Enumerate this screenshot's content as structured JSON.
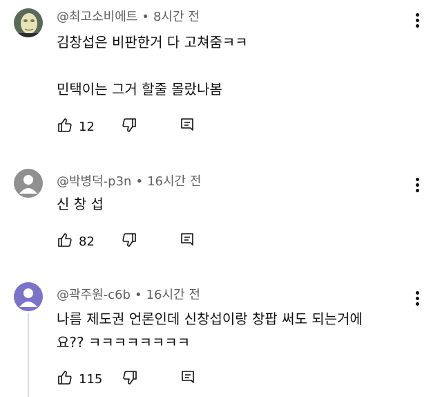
{
  "comments": [
    {
      "author": "@최고소비에트",
      "time": "8시간 전",
      "text": "김창섭은 비판한거 다 고쳐줌ㅋㅋ\n\n민택이는 그거 할줄 몰랐나봄",
      "likes": "12",
      "avatar": "photo"
    },
    {
      "author": "@박병덕-p3n",
      "time": "16시간 전",
      "text": "신 창 섭",
      "likes": "82",
      "avatar": "default-gray"
    },
    {
      "author": "@곽주원-c6b",
      "time": "16시간 전",
      "text": "나름 제도권 언론인데 신창섭이랑 창팝 써도 되는거에\n요?? ㅋㅋㅋㅋㅋㅋㅋㅋ",
      "likes": "115",
      "avatar": "default-purple"
    }
  ],
  "meta_separator": "•",
  "colors": {
    "meta": "#606060",
    "text": "#0f0f0f",
    "avatar_gray": "#909090",
    "avatar_purple": "#7c72c9"
  }
}
